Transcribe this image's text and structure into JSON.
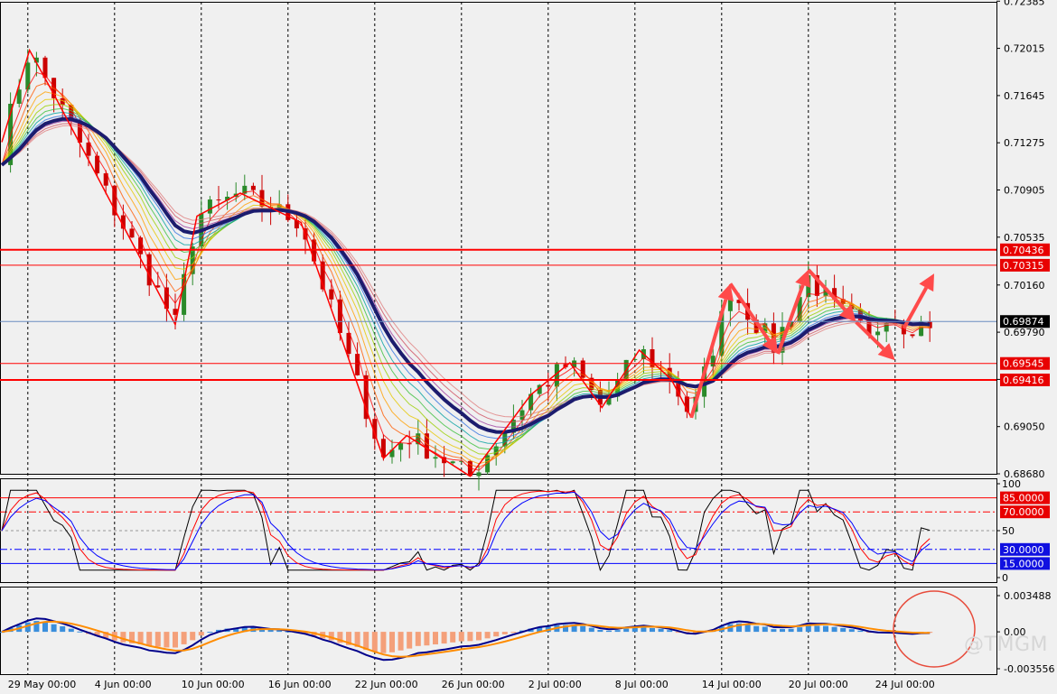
{
  "watermark": "@TMGM",
  "chart_data": [
    {
      "type": "candlestick",
      "panel": "price",
      "ylim": [
        0.6868,
        0.7238
      ],
      "y_ticks": [
        "0.72385",
        "0.72015",
        "0.71645",
        "0.71275",
        "0.70905",
        "0.70535",
        "0.70160",
        "0.69790",
        "0.69420",
        "0.69050",
        "0.68680"
      ],
      "current_price": "0.69874",
      "levels": [
        {
          "label": "0.70436",
          "value": 0.70436,
          "color": "#ff0000",
          "width": 2
        },
        {
          "label": "0.70315",
          "value": 0.70315,
          "color": "#ff0000",
          "width": 1
        },
        {
          "label": "0.69545",
          "value": 0.69545,
          "color": "#ff0000",
          "width": 1
        },
        {
          "label": "0.69416",
          "value": 0.69416,
          "color": "#ff0000",
          "width": 2
        }
      ],
      "zigzag": [
        [
          0,
          0.7128
        ],
        [
          3.2,
          0.72
        ],
        [
          6.2,
          0.7163
        ],
        [
          20,
          0.6985
        ],
        [
          22.5,
          0.707
        ],
        [
          27.5,
          0.7088
        ],
        [
          34.5,
          0.7065
        ],
        [
          44,
          0.688
        ],
        [
          46.7,
          0.6898
        ],
        [
          54,
          0.6866
        ],
        [
          61,
          0.693
        ],
        [
          65.5,
          0.6955
        ],
        [
          69.2,
          0.692
        ],
        [
          73.5,
          0.6965
        ],
        [
          77.2,
          0.6942
        ],
        [
          79.5,
          0.6912
        ]
      ],
      "arrows": [
        [
          [
            79.5,
            0.6912
          ],
          [
            84,
            0.7017
          ]
        ],
        [
          [
            84,
            0.7017
          ],
          [
            89.5,
            0.6962
          ]
        ],
        [
          [
            89.5,
            0.6962
          ],
          [
            93,
            0.7028
          ]
        ],
        [
          [
            93,
            0.7028
          ],
          [
            98.5,
            0.6987
          ]
        ],
        [
          [
            98.5,
            0.6987
          ],
          [
            103,
            0.6957
          ]
        ],
        [
          [
            104,
            0.6982
          ],
          [
            107.5,
            0.7025
          ]
        ]
      ]
    },
    {
      "type": "line",
      "panel": "oscillator",
      "ylim": [
        0,
        100
      ],
      "y_ticks": [
        "100",
        "50",
        "0"
      ],
      "levels": [
        {
          "label": "85.0000",
          "value": 85,
          "color": "#ff0000"
        },
        {
          "label": "70.0000",
          "value": 70,
          "color": "#ff0000"
        },
        {
          "label": "30.0000",
          "value": 30,
          "color": "#0000ff"
        },
        {
          "label": "15.0000",
          "value": 15,
          "color": "#0000ff"
        }
      ]
    },
    {
      "type": "bar",
      "panel": "macd",
      "ylim": [
        -0.003556,
        0.003488
      ],
      "y_ticks": [
        "0.003488",
        "0.00",
        "-0.003556"
      ]
    }
  ],
  "x_axis": {
    "labels": [
      {
        "text": "29 May 00:00",
        "bar": 3
      },
      {
        "text": "4 Jun 00:00",
        "bar": 13
      },
      {
        "text": "10 Jun 00:00",
        "bar": 23
      },
      {
        "text": "16 Jun 00:00",
        "bar": 33
      },
      {
        "text": "22 Jun 00:00",
        "bar": 43
      },
      {
        "text": "26 Jun 00:00",
        "bar": 53
      },
      {
        "text": "2 Jul 00:00",
        "bar": 63
      },
      {
        "text": "8 Jul 00:00",
        "bar": 73
      },
      {
        "text": "14 Jul 00:00",
        "bar": 83
      },
      {
        "text": "20 Jul 00:00",
        "bar": 93
      },
      {
        "text": "24 Jul 00:00",
        "bar": 103
      }
    ]
  },
  "colors": {
    "background": "#f0f0f0",
    "grid": "#000000",
    "bull": "#2a8a2a",
    "bear": "#cc0000",
    "ma_thick": "#1c1c6e",
    "zigzag": "#ff0000",
    "arrow": "#ff4a4a",
    "osc_main": "#000000",
    "osc_signal1": "#ff0000",
    "osc_signal2": "#0000ff",
    "macd_pos": "#3b8fdc",
    "macd_neg": "#f4a07a",
    "macd_line": "#00008b",
    "macd_signal": "#ff8c00",
    "circle": "#e74c3c"
  }
}
